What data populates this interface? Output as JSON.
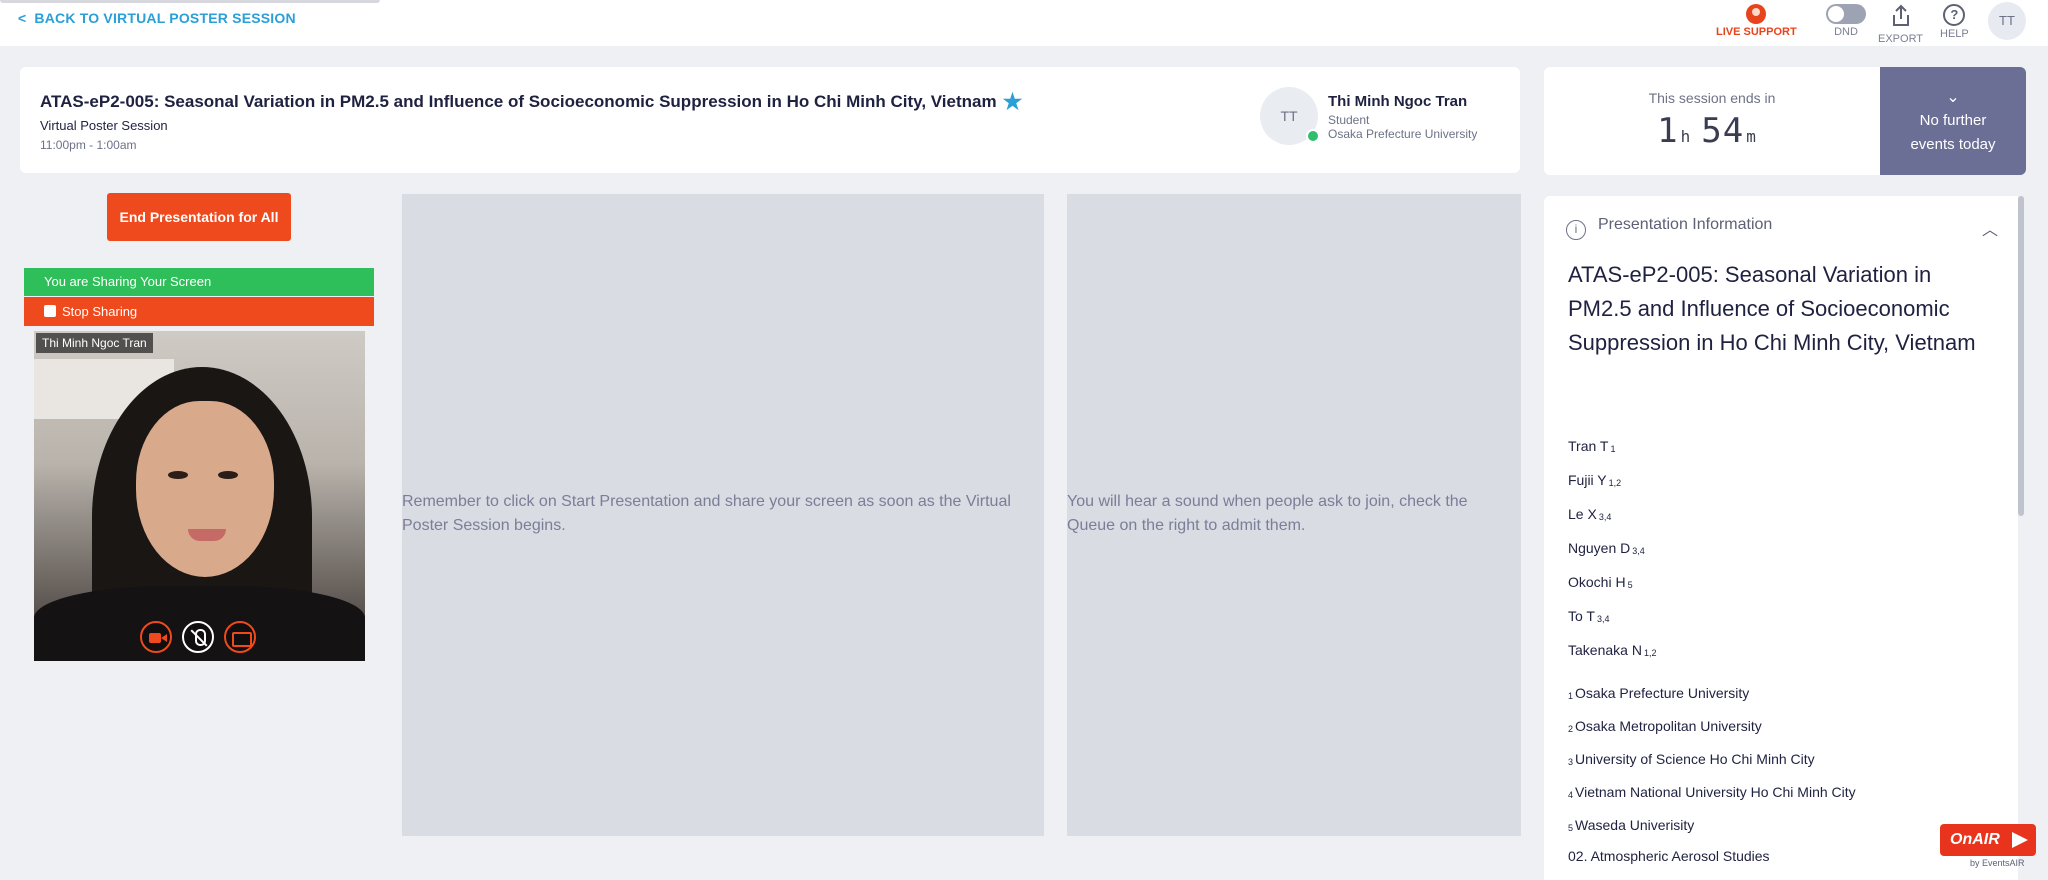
{
  "topbar": {
    "back_label": "BACK TO VIRTUAL POSTER SESSION",
    "live_support": "LIVE SUPPORT",
    "dnd": "DND",
    "export": "EXPORT",
    "help": "HELP",
    "user_initials": "TT"
  },
  "session": {
    "title": "ATAS-eP2-005: Seasonal Variation in PM2.5 and Influence of Socioeconomic Suppression in Ho Chi Minh City, Vietnam",
    "type": "Virtual Poster Session",
    "time": "11:00pm - 1:00am"
  },
  "presenter": {
    "initials": "TT",
    "name": "Thi Minh Ngoc Tran",
    "role": "Student",
    "affiliation": "Osaka Prefecture University"
  },
  "timer": {
    "label": "This session ends in",
    "hours": "1",
    "hours_unit": "h",
    "minutes": "54",
    "minutes_unit": "m",
    "next_line1": "No further",
    "next_line2": "events today"
  },
  "controls": {
    "end_presentation": "End Presentation for All",
    "sharing_status": "You are Sharing Your Screen",
    "stop_sharing": "Stop Sharing"
  },
  "video": {
    "name_tag": "Thi Minh Ngoc Tran"
  },
  "panels": {
    "left_message": "Remember to click on Start Presentation and share your screen as soon as the Virtual Poster Session begins.",
    "right_message": "You will hear a sound when people ask to join, check the Queue on the right to admit them."
  },
  "info": {
    "header": "Presentation Information",
    "title": "ATAS-eP2-005: Seasonal Variation in PM2.5 and Influence of Socioeconomic Suppression in Ho Chi Minh City, Vietnam",
    "authors": [
      {
        "name": "Tran T",
        "sup": "1"
      },
      {
        "name": "Fujii Y",
        "sup": "1,2"
      },
      {
        "name": "Le X",
        "sup": "3,4"
      },
      {
        "name": "Nguyen D",
        "sup": "3,4"
      },
      {
        "name": "Okochi H",
        "sup": "5"
      },
      {
        "name": "To T",
        "sup": "3,4"
      },
      {
        "name": "Takenaka N",
        "sup": "1,2"
      }
    ],
    "affiliations": [
      {
        "sup": "1",
        "name": "Osaka Prefecture University"
      },
      {
        "sup": "2",
        "name": "Osaka Metropolitan University"
      },
      {
        "sup": "3",
        "name": "University of Science Ho Chi Minh City"
      },
      {
        "sup": "4",
        "name": "Vietnam National University Ho Chi Minh City"
      },
      {
        "sup": "5",
        "name": "Waseda Univerisity"
      }
    ],
    "topic": "02. Atmospheric Aerosol Studies"
  },
  "branding": {
    "logo": "OnAIR",
    "by": "by EventsAIR"
  },
  "colors": {
    "accent_blue": "#2a9fd8",
    "alert_orange": "#ee4a1d",
    "success_green": "#2fbf5a",
    "timer_purple": "#6b6e95"
  }
}
